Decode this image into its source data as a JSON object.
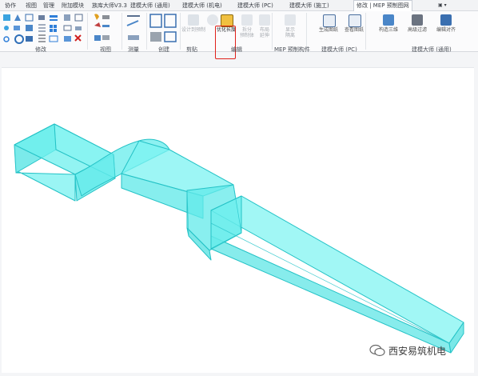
{
  "tabs": [
    {
      "label": "协作"
    },
    {
      "label": "视图"
    },
    {
      "label": "管理"
    },
    {
      "label": "附加模块"
    },
    {
      "label": "族库大师V3.3"
    },
    {
      "label": "建模大师 (通用)"
    },
    {
      "label": "建模大师 (机电)"
    },
    {
      "label": "建模大师 (PC)"
    },
    {
      "label": "建模大师 (施工)"
    },
    {
      "label": "修改 | MEP 预制图网"
    }
  ],
  "ribbon": {
    "panels": [
      {
        "label": "修改"
      },
      {
        "label": "视图"
      },
      {
        "label": "测量"
      },
      {
        "label": "创建"
      },
      {
        "label": "剪贴"
      },
      {
        "label": "编辑"
      },
      {
        "label": "MEP 预制构件"
      },
      {
        "label": "建模大师 (PC)"
      },
      {
        "label": "建模大师 (通用)"
      }
    ],
    "tools": [
      {
        "label": "设计到预制"
      },
      {
        "label": "优化长度"
      },
      {
        "label": "拆分",
        "label2": "预制体"
      },
      {
        "label": "布局",
        "label2": "延伸"
      },
      {
        "label": "显示",
        "label2": "隔离"
      },
      {
        "label": "生成图纸"
      },
      {
        "label": "查看图纸"
      },
      {
        "label": "构造三维"
      },
      {
        "label": "高级过滤"
      },
      {
        "label": "编辑对齐"
      }
    ],
    "highlighted_tool": "优化长度"
  },
  "watermark": {
    "text": "西安易筑机电"
  },
  "colors": {
    "duct_fill": "#5fe6e6",
    "duct_edge": "#2fc7cc",
    "highlight": "#e0211b"
  }
}
